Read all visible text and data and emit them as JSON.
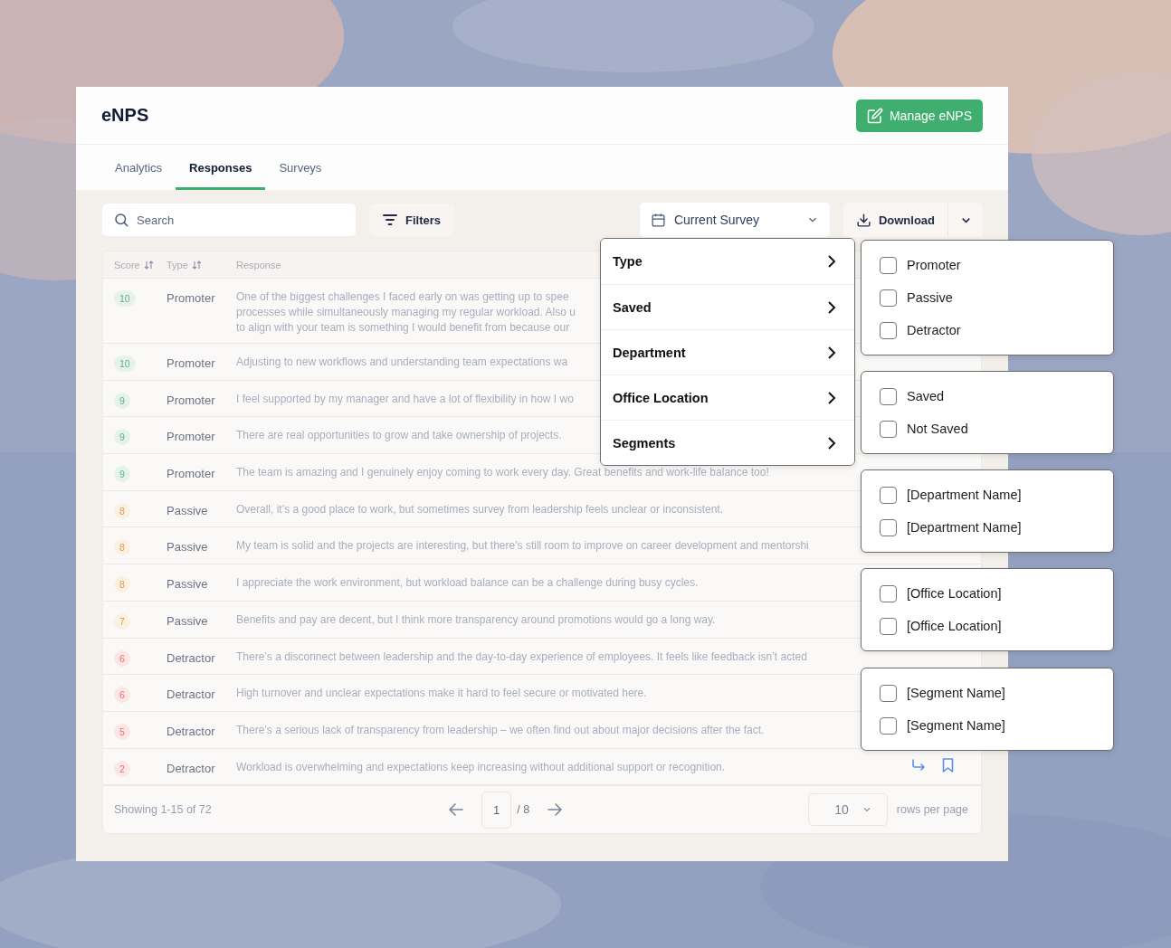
{
  "header": {
    "title": "eNPS",
    "action": "Manage eNPS"
  },
  "tabs": [
    {
      "label": "Analytics",
      "selected": false
    },
    {
      "label": "Responses",
      "selected": true
    },
    {
      "label": "Surveys",
      "selected": false
    }
  ],
  "toolbar": {
    "search": {
      "placeholder": "Search"
    },
    "filters": "Filters",
    "survey": "Current Survey",
    "download": "Download"
  },
  "table": {
    "columns": [
      {
        "label": "Score",
        "sortable": true
      },
      {
        "label": "Type",
        "sortable": true
      },
      {
        "label": "Response",
        "sortable": false
      }
    ],
    "rows": [
      {
        "score": "10",
        "type": "Promoter",
        "kind": "promoter",
        "response": [
          "One of the biggest challenges I faced early on was getting up to spee",
          "processes while simultaneously managing my regular workload. Also u",
          "to align with your team is something I would benefit from because our"
        ]
      },
      {
        "score": "10",
        "type": "Promoter",
        "kind": "promoter",
        "response": [
          "Adjusting to new workflows and understanding team expectations wa"
        ]
      },
      {
        "score": "9",
        "type": "Promoter",
        "kind": "promoter",
        "response": [
          "I feel supported by my manager and have a lot of flexibility in how I wo"
        ]
      },
      {
        "score": "9",
        "type": "Promoter",
        "kind": "promoter",
        "response": [
          "There are real opportunities to grow and take ownership of projects."
        ]
      },
      {
        "score": "9",
        "type": "Promoter",
        "kind": "promoter",
        "response": [
          "The team is amazing and I genuinely enjoy coming to work every day. Great benefits and work-life balance too!"
        ]
      },
      {
        "score": "8",
        "type": "Passive",
        "kind": "passive",
        "response": [
          "Overall, it’s a good place to work, but sometimes survey from leadership feels unclear or inconsistent."
        ]
      },
      {
        "score": "8",
        "type": "Passive",
        "kind": "passive",
        "response": [
          "My team is solid and the projects are interesting, but there’s still room to improve on career development and mentorshi"
        ]
      },
      {
        "score": "8",
        "type": "Passive",
        "kind": "passive",
        "response": [
          "I appreciate the work environment, but workload balance can be a challenge during busy cycles."
        ]
      },
      {
        "score": "7",
        "type": "Passive",
        "kind": "passive",
        "response": [
          "Benefits and pay are decent, but I think more transparency around promotions would go a long way."
        ]
      },
      {
        "score": "6",
        "type": "Detractor",
        "kind": "detractor",
        "response": [
          "There’s a disconnect between leadership and the day-to-day experience of employees. It feels like feedback isn’t acted"
        ]
      },
      {
        "score": "6",
        "type": "Detractor",
        "kind": "detractor",
        "response": [
          "High turnover and unclear expectations make it hard to feel secure or motivated here."
        ]
      },
      {
        "score": "5",
        "type": "Detractor",
        "kind": "detractor",
        "response": [
          "There’s a serious lack of transparency from leadership – we often find out about major decisions after the fact."
        ]
      },
      {
        "score": "2",
        "type": "Detractor",
        "kind": "detractor",
        "response": [
          "Workload is overwhelming and expectations keep increasing without additional support or recognition."
        ],
        "actions": true
      }
    ]
  },
  "pagination": {
    "showing": "Showing 1-15 of 72",
    "page": "1",
    "total": "/ 8",
    "rows": "10",
    "rows_label": "rows per page"
  },
  "filter_menu": [
    {
      "label": "Type",
      "options": [
        {
          "label": "Promoter",
          "checked": false
        },
        {
          "label": "Passive",
          "checked": false
        },
        {
          "label": "Detractor",
          "checked": false
        }
      ]
    },
    {
      "label": "Saved",
      "options": [
        {
          "label": "Saved",
          "checked": false
        },
        {
          "label": "Not Saved",
          "checked": false
        }
      ]
    },
    {
      "label": "Department",
      "options": [
        {
          "label": "[Department Name]",
          "checked": false
        },
        {
          "label": "[Department Name]",
          "checked": false
        }
      ]
    },
    {
      "label": "Office Location",
      "options": [
        {
          "label": "[Office Location]",
          "checked": false
        },
        {
          "label": "[Office Location]",
          "checked": false
        }
      ]
    },
    {
      "label": "Segments",
      "options": [
        {
          "label": "[Segment Name]",
          "checked": false
        },
        {
          "label": "[Segment Name]",
          "checked": false
        }
      ]
    }
  ]
}
